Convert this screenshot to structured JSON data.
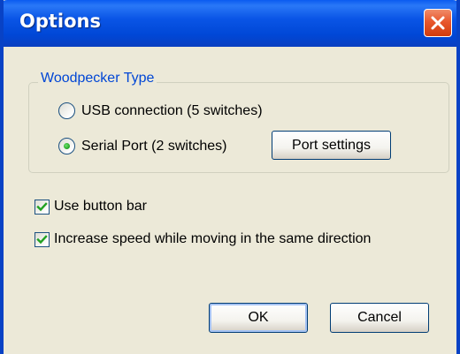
{
  "window": {
    "title": "Options"
  },
  "woodpecker_group": {
    "label": "Woodpecker Type",
    "options": [
      {
        "label": "USB connection (5 switches)",
        "selected": false
      },
      {
        "label": "Serial Port (2 switches)",
        "selected": true
      }
    ],
    "port_settings_label": "Port settings"
  },
  "checkboxes": [
    {
      "label": "Use button bar",
      "checked": true
    },
    {
      "label": "Increase speed while moving in the same direction",
      "checked": true
    }
  ],
  "buttons": {
    "ok_label": "OK",
    "cancel_label": "Cancel"
  },
  "colors": {
    "titlebar": "#0054e3",
    "close_button": "#e0531f",
    "group_label": "#0046d5",
    "dialog_background": "#ece9d8",
    "check_mark": "#21a121"
  },
  "icons": {
    "close": "close-icon",
    "check": "check-icon"
  }
}
